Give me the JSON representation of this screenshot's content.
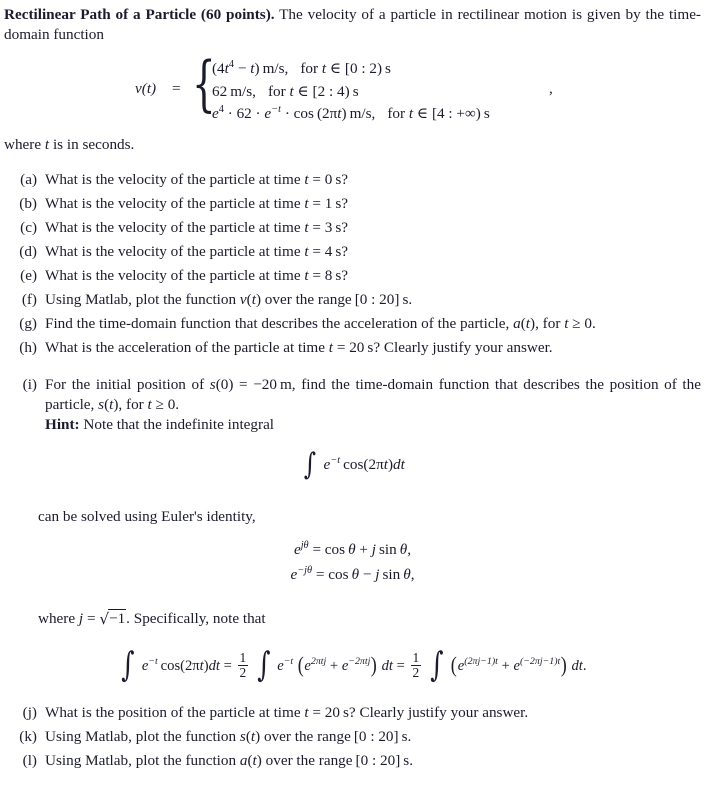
{
  "document": {
    "title_bold": "Rectilinear Path of a Particle (60 points).",
    "intro_text": "The velocity of a particle in rectilinear motion is given by the time-domain function",
    "where_t": "where t is in seconds.",
    "trailing_comma": ","
  },
  "equation_piecewise": {
    "lhs": "v(t)",
    "equals": "=",
    "rows": [
      {
        "expr": "(4t4 − t) m/s,",
        "condition": "for t ∈ [0 : 2) s"
      },
      {
        "expr": "62 m/s,",
        "condition": "for t ∈ [2 : 4) s"
      },
      {
        "expr": "e4 · 62 · e−t · cos (2πt) m/s,",
        "condition": "for t ∈ [4 : +∞) s"
      }
    ]
  },
  "items": [
    {
      "label": "(a)",
      "text": "What is the velocity of the particle at time t = 0 s?"
    },
    {
      "label": "(b)",
      "text": "What is the velocity of the particle at time t = 1 s?"
    },
    {
      "label": "(c)",
      "text": "What is the velocity of the particle at time t = 3 s?"
    },
    {
      "label": "(d)",
      "text": "What is the velocity of the particle at time t = 4 s?"
    },
    {
      "label": "(e)",
      "text": "What is the velocity of the particle at time t = 8 s?"
    },
    {
      "label": "(f)",
      "text": "Using Matlab, plot the function v(t) over the range [0 : 20] s."
    },
    {
      "label": "(g)",
      "text": "Find the time-domain function that describes the acceleration of the particle, a(t), for t ≥ 0."
    },
    {
      "label": "(h)",
      "text": "What is the acceleration of the particle at time t = 20 s? Clearly justify your answer."
    },
    {
      "label": "(i)",
      "text": "For the initial position of s(0) = −20 m, find the time-domain function that describes the position of the particle, s(t), for t ≥ 0."
    },
    {
      "label": "(j)",
      "text": "What is the position of the particle at time t = 20 s? Clearly justify your answer."
    },
    {
      "label": "(k)",
      "text": "Using Matlab, plot the function s(t) over the range [0 : 20] s."
    },
    {
      "label": "(l)",
      "text": "Using Matlab, plot the function a(t) over the range [0 : 20] s."
    }
  ],
  "hint": {
    "label": "Hint:",
    "lead_text": "Note that the indefinite integral",
    "integral_1": "∫ e−t cos(2πt)dt",
    "solved_text": "can be solved using Euler's identity,",
    "euler_1": "ejθ = cos θ + j sin θ,",
    "euler_2": "e−jθ = cos θ − j sin θ,",
    "where_j_text": "where j = √−1. Specifically, note that",
    "integral_chain": "∫ e−t cos(2πt)dt = 1/2 ∫ e−t (e2πtj + e−2πtj) dt = 1/2 ∫ (e(2πj−1)t + e(−2πj−1)t) dt."
  },
  "style": {
    "text_color": "#1b1b2f",
    "background": "#ffffff"
  }
}
